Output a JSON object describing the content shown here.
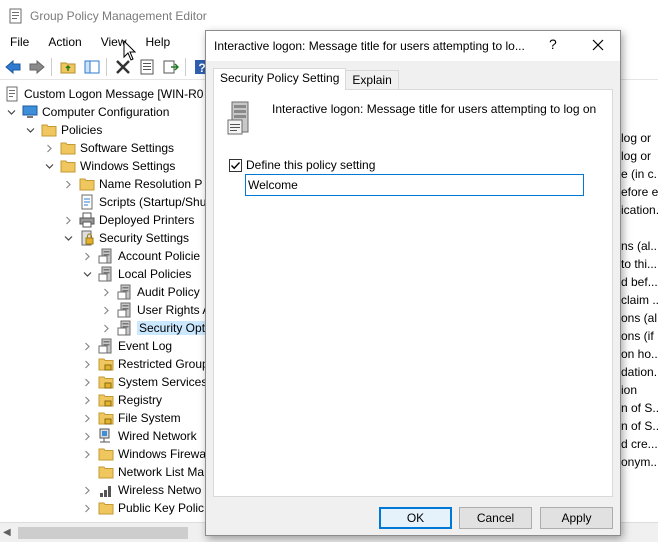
{
  "app": {
    "title": "Group Policy Management Editor"
  },
  "menu": [
    "File",
    "Action",
    "View",
    "Help"
  ],
  "tree": [
    {
      "label": "Custom Logon Message [WIN-R0",
      "indent": 0,
      "chev": "",
      "icon": "policy-doc-icon"
    },
    {
      "label": "Computer Configuration",
      "indent": 1,
      "chev": "down",
      "icon": "computer-icon"
    },
    {
      "label": "Policies",
      "indent": 2,
      "chev": "down",
      "icon": "folder-icon"
    },
    {
      "label": "Software Settings",
      "indent": 3,
      "chev": "right",
      "icon": "folder-icon"
    },
    {
      "label": "Windows Settings",
      "indent": 3,
      "chev": "down",
      "icon": "folder-icon"
    },
    {
      "label": "Name Resolution P",
      "indent": 4,
      "chev": "right",
      "icon": "folder-icon"
    },
    {
      "label": "Scripts (Startup/Shu",
      "indent": 4,
      "chev": "",
      "icon": "script-icon"
    },
    {
      "label": "Deployed Printers",
      "indent": 4,
      "chev": "right",
      "icon": "printer-icon"
    },
    {
      "label": "Security Settings",
      "indent": 4,
      "chev": "down",
      "icon": "security-icon"
    },
    {
      "label": "Account Policie",
      "indent": 5,
      "chev": "right",
      "icon": "policy-icon"
    },
    {
      "label": "Local Policies",
      "indent": 5,
      "chev": "down",
      "icon": "policy-icon"
    },
    {
      "label": "Audit Policy",
      "indent": 6,
      "chev": "right",
      "icon": "policy-icon"
    },
    {
      "label": "User Rights A",
      "indent": 6,
      "chev": "right",
      "icon": "policy-icon"
    },
    {
      "label": "Security Opt",
      "indent": 6,
      "chev": "right",
      "icon": "policy-icon",
      "selected": true
    },
    {
      "label": "Event Log",
      "indent": 5,
      "chev": "right",
      "icon": "policy-icon"
    },
    {
      "label": "Restricted Group",
      "indent": 5,
      "chev": "right",
      "icon": "lock-folder-icon"
    },
    {
      "label": "System Services",
      "indent": 5,
      "chev": "right",
      "icon": "lock-folder-icon"
    },
    {
      "label": "Registry",
      "indent": 5,
      "chev": "right",
      "icon": "lock-folder-icon"
    },
    {
      "label": "File System",
      "indent": 5,
      "chev": "right",
      "icon": "lock-folder-icon"
    },
    {
      "label": "Wired Network",
      "indent": 5,
      "chev": "right",
      "icon": "network-icon"
    },
    {
      "label": "Windows Firewa",
      "indent": 5,
      "chev": "right",
      "icon": "folder-icon"
    },
    {
      "label": "Network List Ma",
      "indent": 5,
      "chev": "",
      "icon": "folder-icon"
    },
    {
      "label": "Wireless Netwo",
      "indent": 5,
      "chev": "right",
      "icon": "wireless-icon"
    },
    {
      "label": "Public Key Polic",
      "indent": 5,
      "chev": "right",
      "icon": "folder-icon"
    }
  ],
  "right_pane": [
    "log or",
    "log or",
    "e (in c...",
    "efore e...",
    "ication...",
    "",
    "ns (al...",
    "to thi...",
    "d bef...",
    "claim ...",
    "ons (al...",
    "ons (if ...",
    "on ho...",
    "dation...",
    "ion",
    "n of S...",
    "n of S...",
    "d cre...",
    "onym..."
  ],
  "dialog": {
    "title": "Interactive logon: Message title for users attempting to lo...",
    "help": "?",
    "tabs": [
      "Security Policy Setting",
      "Explain"
    ],
    "policy_name": "Interactive logon: Message title for users attempting to log on",
    "define_label": "Define this policy setting",
    "define_checked": true,
    "input_value": "Welcome",
    "ok_label": "OK",
    "cancel_label": "Cancel",
    "apply_label": "Apply"
  },
  "colors": {
    "accent": "#0078d7",
    "selected_bg": "#cce8ff",
    "folder": "#f0c75e"
  }
}
